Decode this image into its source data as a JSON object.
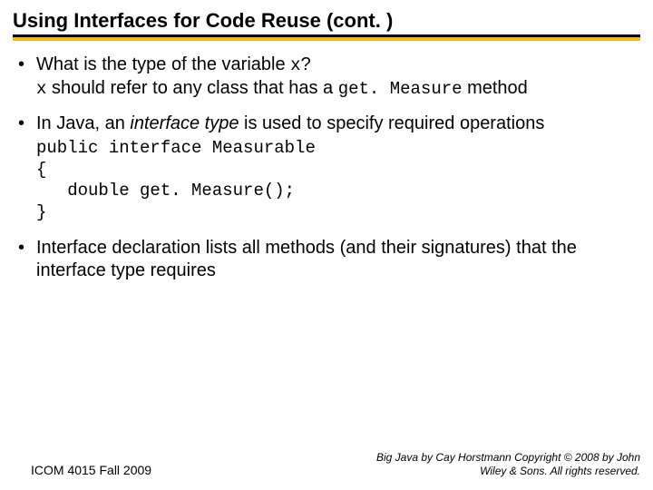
{
  "title": "Using Interfaces for Code Reuse  (cont. )",
  "bullets": {
    "b1": {
      "line1_a": "What is the type of the variable ",
      "line1_code": "x",
      "line1_b": "?",
      "line2_code": "x",
      "line2_a": " should refer to any class that has a ",
      "line2_code2": "get. Measure",
      "line2_b": " method"
    },
    "b2": {
      "text_a": "In Java, an ",
      "text_em": "interface type",
      "text_b": " is used to specify required operations",
      "code": "public interface Measurable\n{\n   double get. Measure();\n}"
    },
    "b3": {
      "text": "Interface declaration lists all methods (and their signatures) that the interface type requires"
    }
  },
  "footer": {
    "left": "ICOM 4015 Fall 2009",
    "right": "Big Java by Cay Horstmann Copyright © 2008 by John Wiley & Sons.  All rights reserved."
  }
}
